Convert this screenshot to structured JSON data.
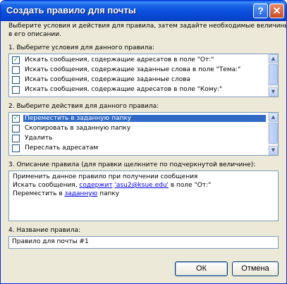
{
  "window": {
    "title": "Создать правило для почты",
    "help_glyph": "?",
    "close_glyph": "✕"
  },
  "intro": [
    "Выберите условия и действия для правила, затем задайте необходимые величины",
    "в его описании."
  ],
  "section1": {
    "label": "1. Выберите условия для данного правила:",
    "items": [
      {
        "label": "Искать сообщения, содержащие адресатов в поле \"От:\"",
        "checked": true
      },
      {
        "label": "Искать сообщения, содержащие заданные слова в поле \"Тема:\"",
        "checked": false
      },
      {
        "label": "Искать сообщения, содержащие заданные слова",
        "checked": false
      },
      {
        "label": "Искать сообщения, содержащие адресатов в поле \"Кому:\"",
        "checked": false
      }
    ]
  },
  "section2": {
    "label": "2. Выберите действия для данного правила:",
    "items": [
      {
        "label": "Переместить в заданную папку",
        "checked": true,
        "selected": true
      },
      {
        "label": "Скопировать в заданную папку",
        "checked": false,
        "selected": false
      },
      {
        "label": "Удалить",
        "checked": false,
        "selected": false
      },
      {
        "label": "Переслать адресатам",
        "checked": false,
        "selected": false
      }
    ]
  },
  "section3": {
    "label": "3. Описание правила (для правки щелкните по подчеркнутой величине):",
    "line1": "Применить данное правило при получении сообщения",
    "line2_pre": "Искать сообщения, ",
    "line2_link1": "содержит",
    "line2_link2": "'asu2@ksue.edu'",
    "line2_post": " в поле \"От:\"",
    "line3_pre": "Переместить в ",
    "line3_link": "заданную",
    "line3_post": " папку"
  },
  "section4": {
    "label": "4. Название правила:",
    "value": "Правило для почты #1"
  },
  "buttons": {
    "ok": "ОК",
    "cancel": "Отмена"
  },
  "scroll_glyphs": {
    "up": "▲",
    "down": "▼"
  },
  "check_glyph": "✓"
}
